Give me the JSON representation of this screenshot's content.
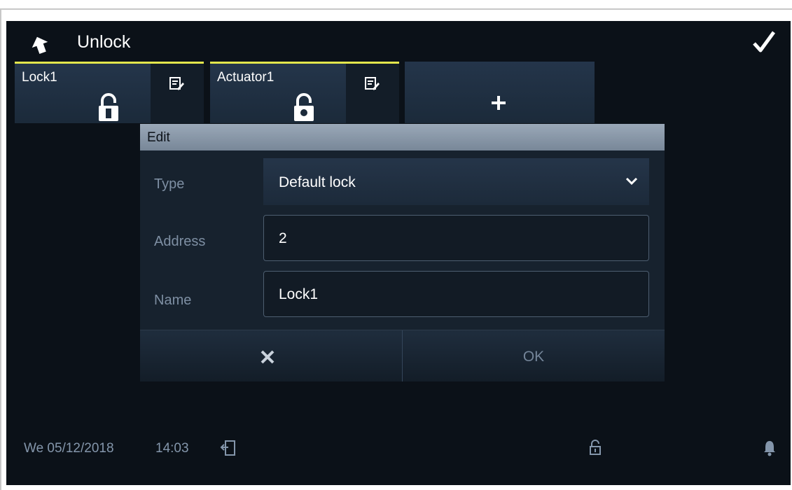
{
  "header": {
    "title": "Unlock"
  },
  "tiles": [
    {
      "name": "Lock1",
      "active": true
    },
    {
      "name": "Actuator1",
      "active": true
    }
  ],
  "dialog": {
    "title": "Edit",
    "fields": {
      "type": {
        "label": "Type",
        "value": "Default lock"
      },
      "address": {
        "label": "Address",
        "value": "2"
      },
      "name": {
        "label": "Name",
        "value": "Lock1"
      }
    },
    "ok_label": "OK"
  },
  "statusbar": {
    "date": "We 05/12/2018",
    "time": "14:03"
  },
  "colors": {
    "accent": "#e3e64c",
    "background": "#0b1118",
    "label": "#7e8fa3"
  }
}
